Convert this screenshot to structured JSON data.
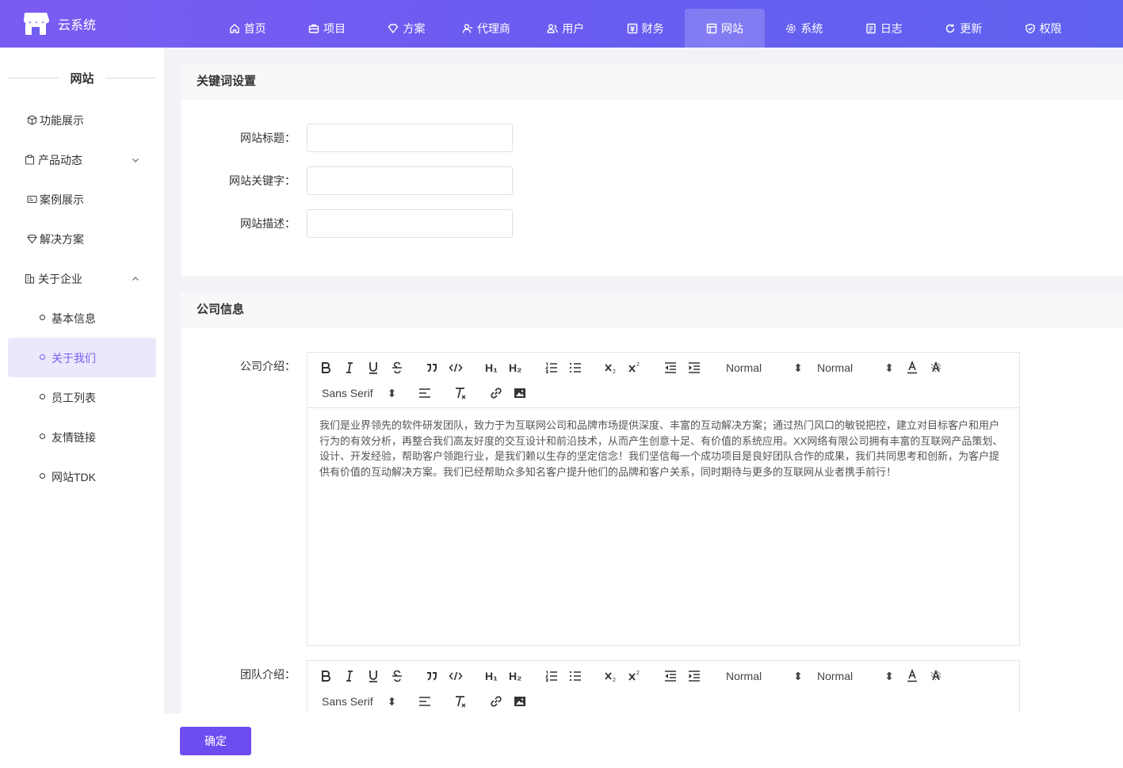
{
  "app": {
    "title": "云系统"
  },
  "nav": [
    {
      "label": "首页",
      "icon": "home-icon"
    },
    {
      "label": "项目",
      "icon": "briefcase-icon"
    },
    {
      "label": "方案",
      "icon": "diamond-icon"
    },
    {
      "label": "代理商",
      "icon": "agent-icon"
    },
    {
      "label": "用户",
      "icon": "users-icon"
    },
    {
      "label": "财务",
      "icon": "finance-icon"
    },
    {
      "label": "网站",
      "icon": "website-icon",
      "active": true
    },
    {
      "label": "系统",
      "icon": "settings-icon"
    },
    {
      "label": "日志",
      "icon": "log-icon"
    },
    {
      "label": "更新",
      "icon": "refresh-icon"
    },
    {
      "label": "权限",
      "icon": "shield-check-icon"
    }
  ],
  "sidebar": {
    "title": "网站",
    "items": [
      {
        "label": "功能展示",
        "icon": "cube-icon"
      },
      {
        "label": "产品动态",
        "icon": "clipboard-icon",
        "expanded": false
      },
      {
        "label": "案例展示",
        "icon": "card-icon"
      },
      {
        "label": "解决方案",
        "icon": "diamond-icon"
      },
      {
        "label": "关于企业",
        "icon": "building-icon",
        "expanded": true
      }
    ],
    "subitems": [
      {
        "label": "基本信息"
      },
      {
        "label": "关于我们",
        "active": true
      },
      {
        "label": "员工列表"
      },
      {
        "label": "友情链接"
      },
      {
        "label": "网站TDK"
      }
    ]
  },
  "keywords": {
    "title": "关键词设置",
    "fields": [
      {
        "label": "网站标题：",
        "value": ""
      },
      {
        "label": "网站关键字：",
        "value": ""
      },
      {
        "label": "网站描述：",
        "value": ""
      }
    ]
  },
  "company": {
    "title": "公司信息",
    "intro_label": "公司介绍：",
    "intro_text": "我们是业界领先的软件研发团队，致力于为互联网公司和品牌市场提供深度、丰富的互动解决方案；通过热门风口的敏锐把控，建立对目标客户和用户行为的有效分析，再整合我们高友好度的交互设计和前沿技术，从而产生创意十足、有价值的系统应用。XX网络有限公司拥有丰富的互联网产品策划、设计、开发经验，帮助客户领跑行业，是我们赖以生存的坚定信念！我们坚信每一个成功项目是良好团队合作的成果，我们共同思考和创新，为客户提供有价值的互动解决方案。我们已经帮助众多知名客户提升他们的品牌和客户关系，同时期待与更多的互联网从业者携手前行！",
    "team_label": "团队介绍："
  },
  "toolbar": {
    "header_select": "Normal",
    "size_select": "Normal",
    "font_select": "Sans Serif",
    "h1": "H₁",
    "h2": "H₂"
  },
  "footer": {
    "confirm_label": "确定"
  },
  "colors": {
    "accent": "#6d4df0",
    "nav_gradient_start": "#7b5cf2",
    "nav_gradient_end": "#5f63ef"
  }
}
